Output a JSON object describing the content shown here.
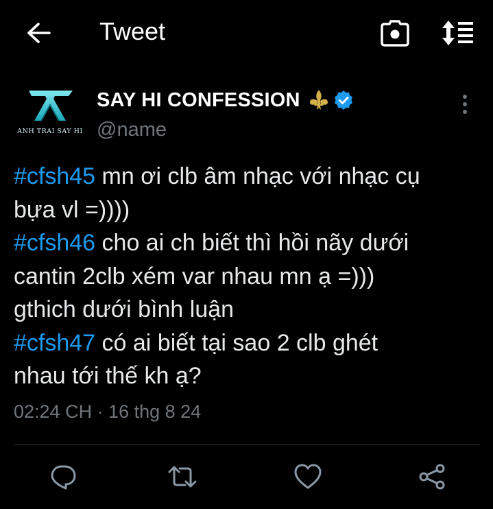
{
  "header": {
    "title": "Tweet",
    "icons": {
      "back": "arrow-left-icon",
      "camera": "camera-icon",
      "sort": "sort-icon"
    }
  },
  "author": {
    "avatar_text": "ANH TRAI SAY HI",
    "display_name": "SAY HI CONFESSION",
    "handle": "@name",
    "badges": [
      "fleur-de-lis-icon",
      "verified-badge-icon"
    ]
  },
  "tweet": {
    "lines": [
      {
        "hashtag": "#cfsh45",
        "text": " mn ơi clb âm nhạc với nhạc cụ\nbựa vl =))))"
      },
      {
        "hashtag": "#cfsh46",
        "text": " cho ai ch biết thì hồi nãy dưới\ncantin 2clb xém var nhau mn ạ =)))\ngthich dưới bình luận"
      },
      {
        "hashtag": "#cfsh47",
        "text": " có ai biết tại sao 2 clb ghét\nnhau tới thế kh ạ?"
      }
    ],
    "timestamp": "02:24 CH · 16 thg 8 24"
  },
  "actions": {
    "icons": [
      "reply-icon",
      "retweet-icon",
      "like-icon",
      "share-icon"
    ]
  },
  "colors": {
    "background": "#000000",
    "text": "#e7e9ea",
    "muted": "#71767b",
    "accent": "#1d9bf0",
    "divider": "#2f3336",
    "verified": "#1d9bf0",
    "fleur": "#d4b04a"
  }
}
